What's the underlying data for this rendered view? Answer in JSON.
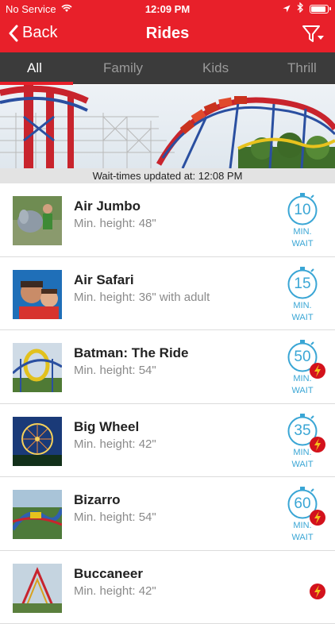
{
  "status": {
    "carrier": "No Service",
    "time": "12:09 PM"
  },
  "nav": {
    "back_label": "Back",
    "title": "Rides"
  },
  "tabs": [
    {
      "label": "All"
    },
    {
      "label": "Family"
    },
    {
      "label": "Kids"
    },
    {
      "label": "Thrill"
    }
  ],
  "updated_text": "Wait-times updated at: 12:08 PM",
  "wait_unit_line1": "MIN.",
  "wait_unit_line2": "WAIT",
  "rides": [
    {
      "name": "Air Jumbo",
      "height": "Min. height: 48\"",
      "wait": "10",
      "flash": false
    },
    {
      "name": "Air Safari",
      "height": "Min. height: 36\" with adult",
      "wait": "15",
      "flash": false
    },
    {
      "name": "Batman: The Ride",
      "height": "Min. height: 54\"",
      "wait": "50",
      "flash": true
    },
    {
      "name": "Big Wheel",
      "height": "Min. height: 42\"",
      "wait": "35",
      "flash": true
    },
    {
      "name": "Bizarro",
      "height": "Min. height: 54\"",
      "wait": "60",
      "flash": true
    },
    {
      "name": "Buccaneer",
      "height": "Min. height: 42\"",
      "flash": true
    }
  ],
  "colors": {
    "brand_red": "#e8202a",
    "tab_bar": "#3b3b3b",
    "wait_blue": "#3aa6d5"
  }
}
